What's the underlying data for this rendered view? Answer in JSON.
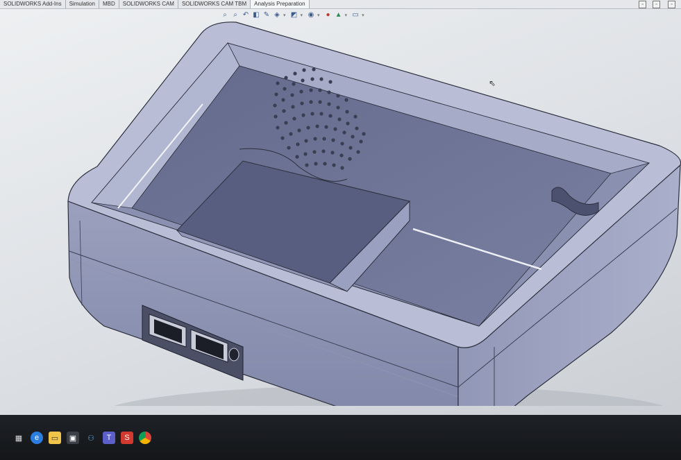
{
  "tabs": [
    {
      "label": "SOLIDWORKS Add-Ins"
    },
    {
      "label": "Simulation"
    },
    {
      "label": "MBD"
    },
    {
      "label": "SOLIDWORKS CAM"
    },
    {
      "label": "SOLIDWORKS CAM TBM"
    },
    {
      "label": "Analysis Preparation"
    }
  ],
  "hud_icons": [
    "zoom-to-fit-icon",
    "zoom-area-icon",
    "previous-view-icon",
    "section-view-icon",
    "dynamic-annotation-icon",
    "view-orientation-icon",
    "display-style-icon",
    "hide-show-icon",
    "edit-appearance-icon",
    "apply-scene-icon",
    "view-settings-icon"
  ],
  "taskbar_icons": [
    "task-view-icon",
    "edge-icon",
    "file-explorer-icon",
    "store-icon",
    "network-icon",
    "teams-icon",
    "solidworks-icon",
    "chrome-icon"
  ],
  "colors": {
    "model_face": "#a3a9c5",
    "model_dark": "#5f6585",
    "model_edge": "#2c2f3c",
    "accent": "#3d5c8c"
  }
}
